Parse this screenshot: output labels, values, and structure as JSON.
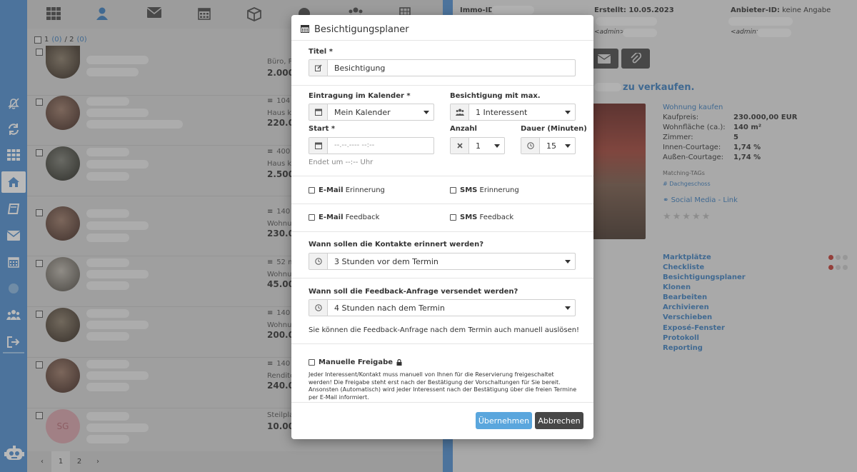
{
  "list": {
    "count_prefix": "1",
    "count_link1": "(0)",
    "count_sep": "/ 2",
    "count_link2": "(0)",
    "rows": [
      {
        "meta": "Büro, P...",
        "price": "2.000,..."
      },
      {
        "meta": "104",
        "meta2": "Haus ka...",
        "price": "220.00..."
      },
      {
        "meta": "400",
        "meta2": "Haus ka...",
        "price": "2.500,..."
      },
      {
        "meta": "140",
        "meta2": "Wohnu...",
        "price": "230.00..."
      },
      {
        "meta": "52 m",
        "meta2": "Wohnu...",
        "price": "45.000..."
      },
      {
        "meta": "140",
        "meta2": "Wohnu...",
        "price": "200.00..."
      },
      {
        "meta": "140",
        "meta2": "Rendite...",
        "price": "240.00..."
      },
      {
        "meta": "Steilpla...",
        "price": "10.000...",
        "initials": "SG"
      }
    ],
    "pager": {
      "prev": "‹",
      "page1": "1",
      "page2": "2",
      "next": "›"
    }
  },
  "detail": {
    "immo_id_label": "Immo-ID:",
    "created": "Erstellt: 10.05.2023",
    "provider_label": "Anbieter-ID:",
    "provider_value": "keine Angabe",
    "admin1": "<admin>",
    "admin2": "<admin>",
    "headline": "zu verkaufen.",
    "link_title": "Wohnung kaufen",
    "facts": [
      {
        "k": "Kaufpreis:",
        "v": "230.000,00 EUR"
      },
      {
        "k": "Wohnfläche (ca.):",
        "v": "140 m²"
      },
      {
        "k": "Zimmer:",
        "v": "5"
      },
      {
        "k": "Innen-Courtage:",
        "v": "1,74 %"
      },
      {
        "k": "Außen-Courtage:",
        "v": "1,74 %"
      }
    ],
    "matching_tags": "Matching-TAGs",
    "tag": "# Dachgeschoss",
    "social_link": "Social Media - Link",
    "stars": "★★★★★",
    "actions": [
      "Marktplätze",
      "Checkliste",
      "Besichtigungsplaner",
      "Klonen",
      "Bearbeiten",
      "Archivieren",
      "Verschieben",
      "Exposé-Fenster",
      "Protokoll",
      "Reporting"
    ]
  },
  "modal": {
    "title": "Besichtigungsplaner",
    "titel_label": "Titel *",
    "titel_value": "Besichtigung",
    "calendar_label": "Eintragung im Kalender *",
    "calendar_value": "Mein Kalender",
    "max_label": "Besichtigung mit max.",
    "max_value": "1 Interessent",
    "start_label": "Start *",
    "start_placeholder": "--.--.---- --:--",
    "anzahl_label": "Anzahl",
    "anzahl_value": "1",
    "dauer_label": "Dauer (Minuten)",
    "dauer_value": "15",
    "end_hint": "Endet um --:-- Uhr",
    "email_reminder_pre": "E-Mail",
    "email_reminder_post": "Erinnerung",
    "sms_reminder_pre": "SMS",
    "sms_reminder_post": "Erinnerung",
    "email_feedback_pre": "E-Mail",
    "email_feedback_post": "Feedback",
    "sms_feedback_pre": "SMS",
    "sms_feedback_post": "Feedback",
    "remind_label": "Wann sollen die Kontakte erinnert werden?",
    "remind_value": "3 Stunden vor dem Termin",
    "feedback_label": "Wann soll die Feedback-Anfrage versendet werden?",
    "feedback_value": "4 Stunden nach dem Termin",
    "feedback_note": "Sie können die Feedback-Anfrage nach dem Termin auch manuell auslösen!",
    "manual_label": "Manuelle Freigabe",
    "manual_text": "Jeder Interessent/Kontakt muss manuell von Ihnen für die Reservierung freigeschaltet werden! Die Freigabe steht erst nach der Bestätigung der Vorschaltungen für Sie bereit. Ansonsten (Automatisch) wird jeder Interessent nach der Bestätigung über die freien Termine per E-Mail informiert.",
    "apply_button": "Übernehmen",
    "cancel_button": "Abbrechen"
  },
  "colors": {
    "accent": "#4f8fd0",
    "link": "#3d7fbf",
    "primary_button": "#5aa6dd",
    "dark_button": "#474747"
  }
}
